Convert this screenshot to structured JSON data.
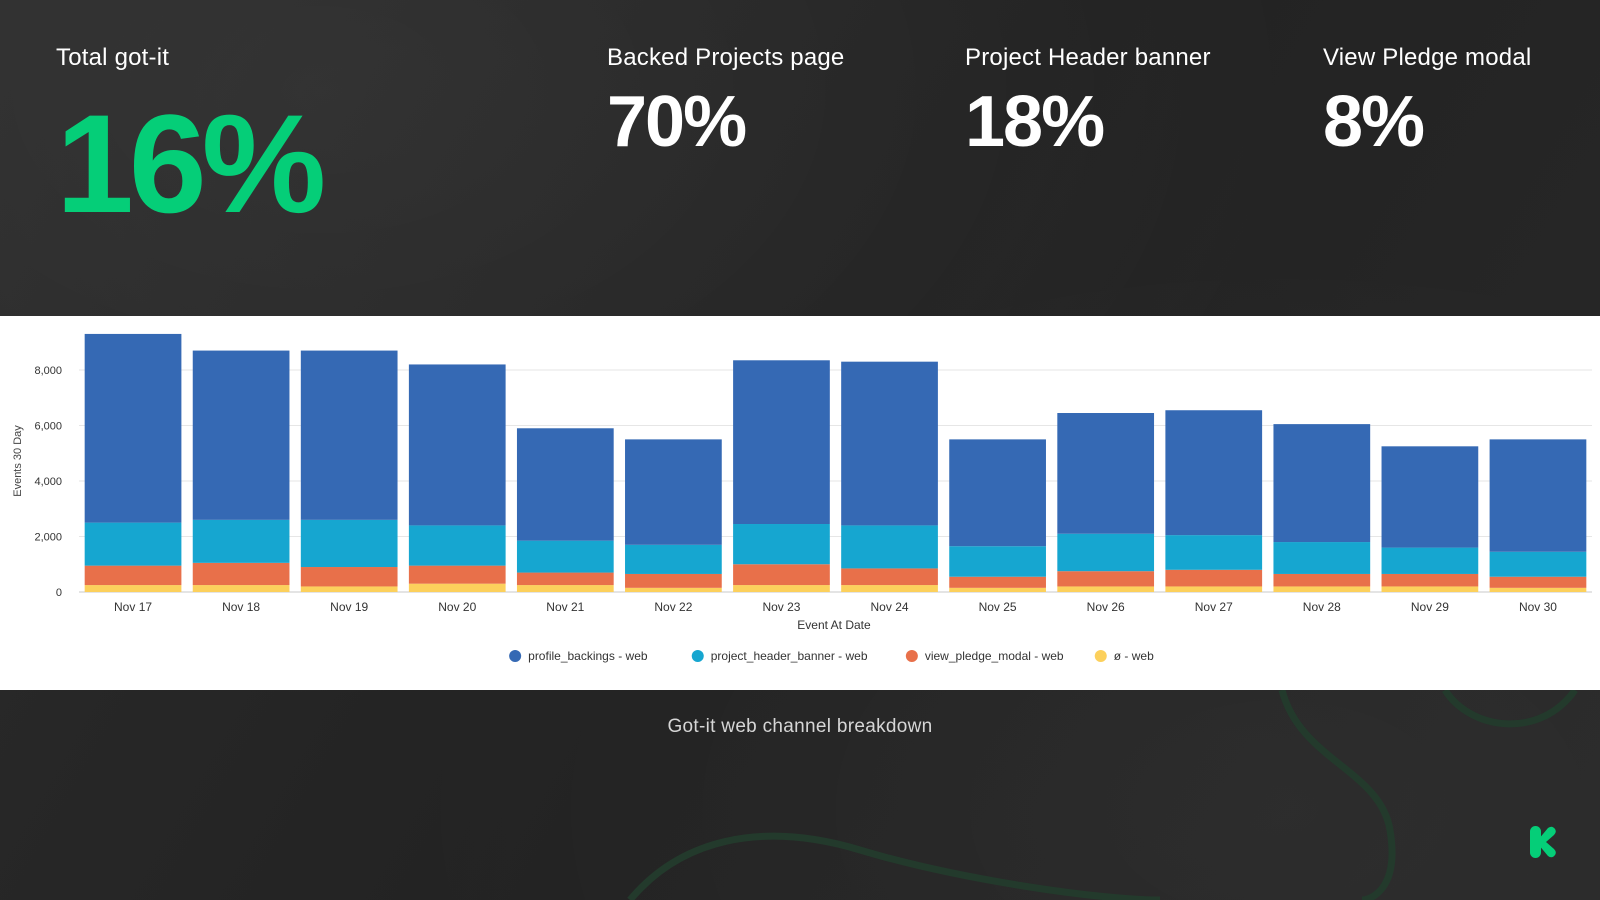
{
  "stats": {
    "total": {
      "label": "Total got-it",
      "value": "16%"
    },
    "backed": {
      "label": "Backed Projects page",
      "value": "70%"
    },
    "header": {
      "label": "Project Header banner",
      "value": "18%"
    },
    "pledge": {
      "label": "View Pledge modal",
      "value": "8%"
    }
  },
  "colors": {
    "accent": "#05ce78",
    "background": "#262626",
    "stat_text": "#ffffff"
  },
  "caption": "Got-it web channel breakdown",
  "chart_data": {
    "type": "bar",
    "stacked": true,
    "xlabel": "Event At Date",
    "ylabel": "Events 30 Day",
    "ylim": [
      0,
      9500
    ],
    "yticks": [
      0,
      2000,
      4000,
      6000,
      8000
    ],
    "ytick_labels": [
      "0",
      "2,000",
      "4,000",
      "6,000",
      "8,000"
    ],
    "grid": true,
    "legend_position": "bottom",
    "categories": [
      "Nov 17",
      "Nov 18",
      "Nov 19",
      "Nov 20",
      "Nov 21",
      "Nov 22",
      "Nov 23",
      "Nov 24",
      "Nov 25",
      "Nov 26",
      "Nov 27",
      "Nov 28",
      "Nov 29",
      "Nov 30"
    ],
    "series": [
      {
        "name": "ø - web",
        "color": "#fcd05c",
        "values": [
          250,
          250,
          200,
          300,
          250,
          150,
          250,
          250,
          150,
          200,
          200,
          200,
          200,
          150
        ]
      },
      {
        "name": "view_pledge_modal - web",
        "color": "#e8704a",
        "values": [
          700,
          800,
          700,
          650,
          450,
          500,
          750,
          600,
          400,
          550,
          600,
          450,
          450,
          400
        ]
      },
      {
        "name": "project_header_banner - web",
        "color": "#16a6d0",
        "values": [
          1550,
          1550,
          1700,
          1450,
          1150,
          1050,
          1450,
          1550,
          1100,
          1350,
          1250,
          1150,
          950,
          900
        ]
      },
      {
        "name": "profile_backings - web",
        "color": "#3569b4",
        "values": [
          6800,
          6100,
          6100,
          5800,
          4050,
          3800,
          5900,
          5900,
          3850,
          4350,
          4500,
          4250,
          3650,
          4050
        ]
      }
    ],
    "legend_order": [
      "profile_backings - web",
      "project_header_banner - web",
      "view_pledge_modal - web",
      "ø - web"
    ]
  }
}
